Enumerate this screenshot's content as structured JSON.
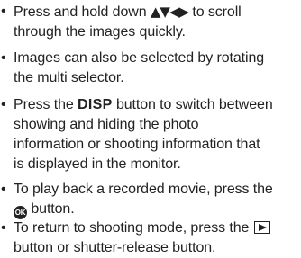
{
  "bullet_glyph": "•",
  "bullets": [
    {
      "line1_pre": "Press and hold down ",
      "arrows": "▲▼◀▶",
      "line1_post": " to scroll",
      "line2": "through the images quickly."
    },
    {
      "line1": "Images can also be selected by rotating",
      "line2": "the multi selector."
    },
    {
      "line1_pre": "Press the ",
      "button_name": "DISP",
      "line1_post": " button to switch between",
      "line2": "showing and hiding the photo",
      "line3": "information or shooting information that",
      "line4": "is displayed in the monitor."
    },
    {
      "line1": "To play back a recorded movie, press the",
      "icon_text": "OK",
      "line2_post": " button."
    },
    {
      "line1_pre": "To return to shooting mode, press the ",
      "line2": "button or shutter-release button."
    }
  ],
  "icons": {
    "arrows": "multi-selector-arrows-icon",
    "ok": "ok-button-icon",
    "playback": "playback-button-icon"
  },
  "colors": {
    "text": "#222222",
    "background": "#ffffff"
  }
}
